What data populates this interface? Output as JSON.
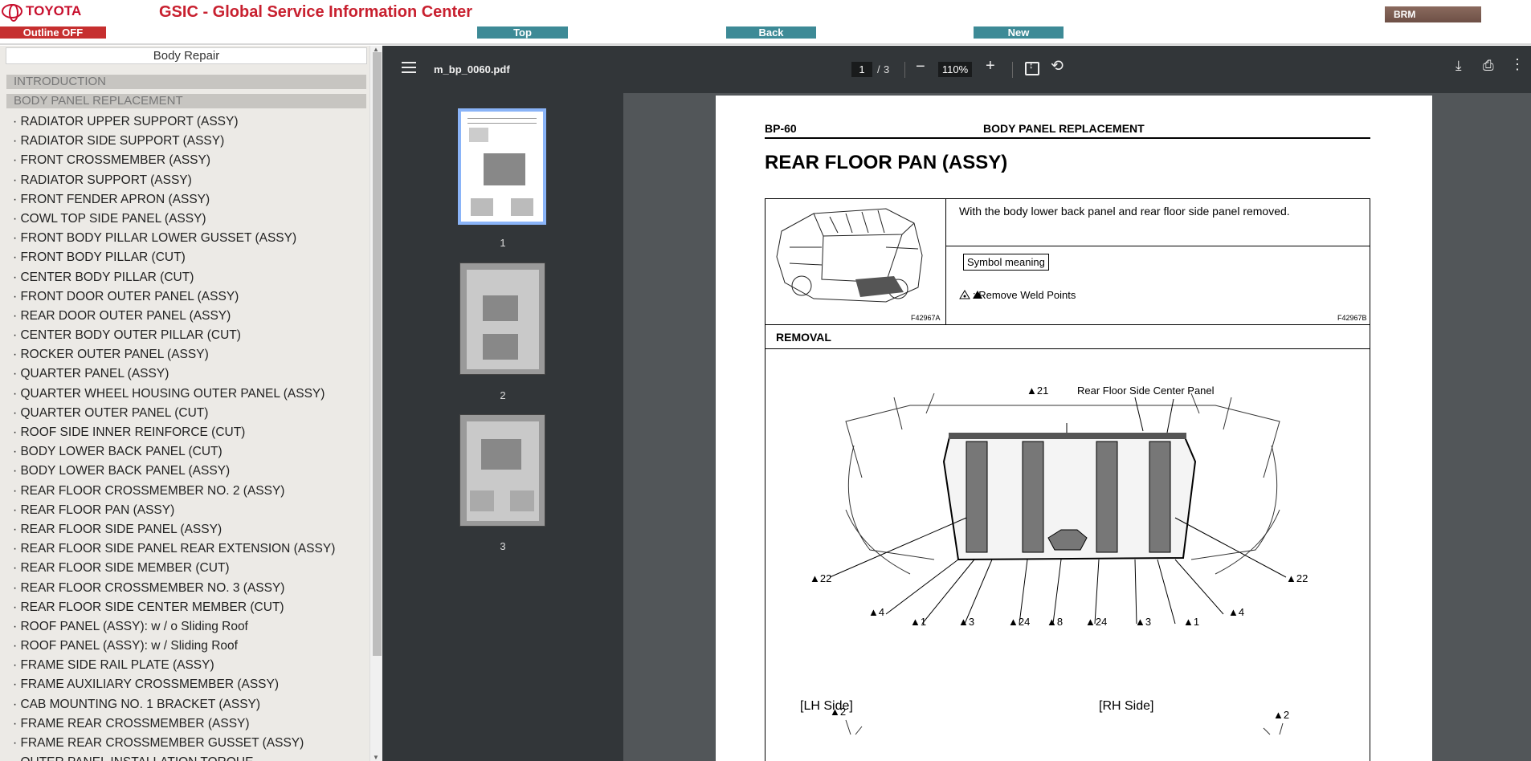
{
  "header": {
    "logo_text": "TOYOTA",
    "app_title": "GSIC - Global Service Information Center",
    "outline_button": "Outline OFF",
    "top_button": "Top",
    "back_button": "Back",
    "new_button": "New",
    "brm_button": "BRM"
  },
  "sidebar": {
    "title": "Body Repair",
    "sections": [
      "INTRODUCTION",
      "BODY PANEL REPLACEMENT"
    ],
    "items": [
      "RADIATOR UPPER SUPPORT (ASSY)",
      "RADIATOR SIDE SUPPORT (ASSY)",
      "FRONT CROSSMEMBER (ASSY)",
      "RADIATOR SUPPORT (ASSY)",
      "FRONT FENDER APRON (ASSY)",
      "COWL TOP SIDE PANEL (ASSY)",
      "FRONT BODY PILLAR LOWER GUSSET (ASSY)",
      "FRONT BODY PILLAR (CUT)",
      "CENTER BODY PILLAR (CUT)",
      "FRONT DOOR OUTER PANEL (ASSY)",
      "REAR DOOR OUTER PANEL (ASSY)",
      "CENTER BODY OUTER PILLAR (CUT)",
      "ROCKER OUTER PANEL (ASSY)",
      "QUARTER PANEL (ASSY)",
      "QUARTER WHEEL HOUSING OUTER PANEL (ASSY)",
      "QUARTER OUTER PANEL (CUT)",
      "ROOF SIDE INNER REINFORCE (CUT)",
      "BODY LOWER BACK PANEL (CUT)",
      "BODY LOWER BACK PANEL (ASSY)",
      "REAR FLOOR CROSSMEMBER NO. 2 (ASSY)",
      "REAR FLOOR PAN (ASSY)",
      "REAR FLOOR SIDE PANEL (ASSY)",
      "REAR FLOOR SIDE PANEL REAR EXTENSION (ASSY)",
      "REAR FLOOR SIDE MEMBER (CUT)",
      "REAR FLOOR CROSSMEMBER NO. 3 (ASSY)",
      "REAR FLOOR SIDE CENTER MEMBER (CUT)",
      "ROOF PANEL (ASSY): w / o Sliding Roof",
      "ROOF PANEL (ASSY): w / Sliding Roof",
      "FRAME SIDE RAIL PLATE (ASSY)",
      "FRAME AUXILIARY CROSSMEMBER (ASSY)",
      "CAB MOUNTING NO. 1 BRACKET (ASSY)",
      "FRAME REAR CROSSMEMBER (ASSY)",
      "FRAME REAR CROSSMEMBER GUSSET (ASSY)",
      "OUTER PANEL INSTALLATION TORQUE"
    ]
  },
  "viewer": {
    "filename": "m_bp_0060.pdf",
    "current_page": "1",
    "page_separator": "/",
    "total_pages": "3",
    "zoom": "110%",
    "thumbnails": [
      "1",
      "2",
      "3"
    ],
    "icons": [
      "menu-icon",
      "zoom-out-icon",
      "zoom-in-icon",
      "fit-page-icon",
      "rotate-icon",
      "download-icon",
      "print-icon",
      "more-icon"
    ]
  },
  "document": {
    "code": "BP-60",
    "header": "BODY PANEL REPLACEMENT",
    "title": "REAR FLOOR PAN (ASSY)",
    "note": "With the body lower back panel and rear floor side panel removed.",
    "symbol_meaning": "Symbol meaning",
    "symbol_text": ": Remove Weld Points",
    "figure_code_a": "F42967A",
    "figure_code_b": "F42967B",
    "removal": "REMOVAL",
    "diagram_label": "Rear Floor Side Center Panel",
    "callouts": {
      "top": "21",
      "left": "22",
      "right": "22",
      "c1": "4",
      "c2": "1",
      "c3": "3",
      "c4": "24",
      "c5": "8",
      "c6": "24",
      "c7": "3",
      "c8": "1",
      "c9": "4"
    },
    "lh_side": "[LH Side]",
    "rh_side": "[RH Side]",
    "lh_callout": "2",
    "rh_callout": "2"
  }
}
